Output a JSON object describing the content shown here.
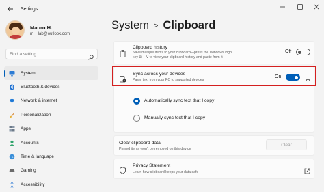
{
  "window": {
    "title": "Settings"
  },
  "user": {
    "name": "Mauro H.",
    "email": "m__lab@outlook.com"
  },
  "search": {
    "placeholder": "Find a setting"
  },
  "nav": {
    "items": [
      {
        "label": "System",
        "icon": "monitor-icon",
        "active": true
      },
      {
        "label": "Bluetooth & devices",
        "icon": "bluetooth-icon"
      },
      {
        "label": "Network & internet",
        "icon": "wifi-icon"
      },
      {
        "label": "Personalization",
        "icon": "brush-icon"
      },
      {
        "label": "Apps",
        "icon": "apps-icon"
      },
      {
        "label": "Accounts",
        "icon": "person-icon"
      },
      {
        "label": "Time & language",
        "icon": "globe-clock-icon"
      },
      {
        "label": "Gaming",
        "icon": "gamepad-icon"
      },
      {
        "label": "Accessibility",
        "icon": "accessibility-icon"
      }
    ]
  },
  "breadcrumb": {
    "parent": "System",
    "separator": ">",
    "current": "Clipboard"
  },
  "clipboard_history": {
    "title": "Clipboard history",
    "description_line1": "Save multiple items to your clipboard—press the Windows logo",
    "description_line2": "key ⊞ + V to view your clipboard history and paste from it",
    "toggle_label": "Off",
    "toggle_on": false
  },
  "sync": {
    "title": "Sync across your devices",
    "description": "Paste text from your PC to supported devices",
    "toggle_label": "On",
    "toggle_on": true,
    "expanded": true,
    "options": [
      {
        "label": "Automatically sync text that I copy",
        "checked": true
      },
      {
        "label": "Manually sync text that I copy",
        "checked": false
      }
    ]
  },
  "clear_data": {
    "title": "Clear clipboard data",
    "description": "Pinned items won't be removed on this device",
    "button_label": "Clear"
  },
  "privacy": {
    "title": "Privacy Statement",
    "description": "Learn how clipboard keeps your data safe"
  },
  "colors": {
    "accent": "#005fb8",
    "highlight_border": "#d42020",
    "background": "#f3f3f3"
  }
}
